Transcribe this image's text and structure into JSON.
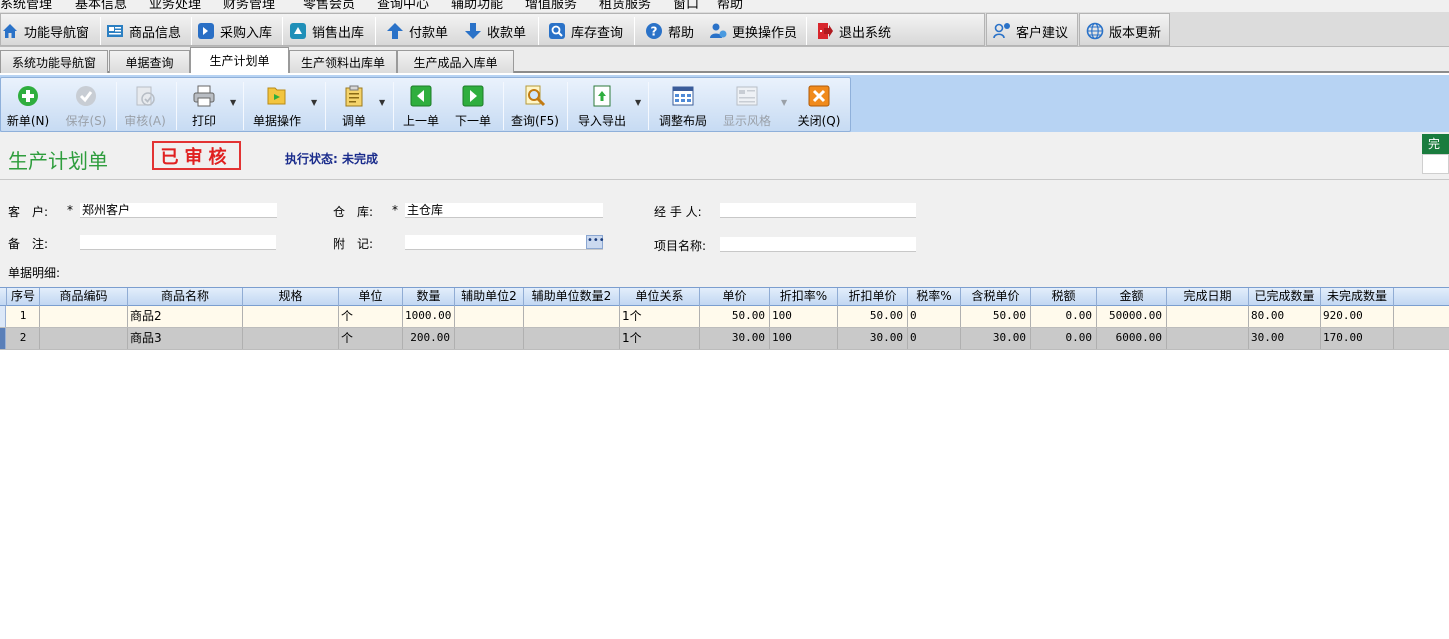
{
  "menu": [
    "系统管理",
    "基本信息",
    "业务处理",
    "财务管理",
    "零售会员",
    "查询中心",
    "辅助功能",
    "增值服务",
    "租赁服务",
    "窗口",
    "帮助"
  ],
  "quickbar": {
    "nav": "功能导航窗",
    "goods": "商品信息",
    "purchase_in": "采购入库",
    "sales_out": "销售出库",
    "payment": "付款单",
    "receipt": "收款单",
    "stock_query": "库存查询",
    "help": "帮助",
    "switch_operator": "更换操作员",
    "exit": "退出系统",
    "feedback": "客户建议",
    "update": "版本更新"
  },
  "tabs": [
    "系统功能导航窗",
    "单据查询",
    "生产计划单",
    "生产领料出库单",
    "生产成品入库单"
  ],
  "active_tab": "生产计划单",
  "toolbar": {
    "new": "新单(N)",
    "save": "保存(S)",
    "audit": "审核(A)",
    "print": "打印",
    "doc_ops": "单据操作",
    "call_doc": "调单",
    "prev": "上一单",
    "next": "下一单",
    "query": "查询(F5)",
    "import_export": "导入导出",
    "adjust_layout": "调整布局",
    "display_style": "显示风格",
    "close": "关闭(Q)"
  },
  "form": {
    "title": "生产计划单",
    "stamp": "已审核",
    "status_label": "执行状态:",
    "status_value": "未完成",
    "corner_tag": "完",
    "customer_label": "客　户:",
    "customer_required": "*",
    "customer_value": "郑州客户",
    "warehouse_label": "仓　库:",
    "warehouse_required": "*",
    "warehouse_value": "主仓库",
    "handler_label": "经 手 人:",
    "handler_value": "",
    "remark_label": "备　注:",
    "remark_value": "",
    "note_label": "附　记:",
    "note_value": "",
    "project_label": "项目名称:",
    "project_value": "",
    "detail_label": "单据明细:"
  },
  "grid": {
    "headers": [
      "序号",
      "商品编码",
      "商品名称",
      "规格",
      "单位",
      "数量",
      "辅助单位2",
      "辅助单位数量2",
      "单位关系",
      "单价",
      "折扣率%",
      "折扣单价",
      "税率%",
      "含税单价",
      "税额",
      "金额",
      "完成日期",
      "已完成数量",
      "未完成数量"
    ],
    "rows": [
      [
        "1",
        "",
        "商品2",
        "",
        "个",
        "1000.00",
        "",
        "",
        "1个",
        "50.00",
        "100",
        "50.00",
        "0",
        "50.00",
        "0.00",
        "50000.00",
        "",
        "80.00",
        "920.00"
      ],
      [
        "2",
        "",
        "商品3",
        "",
        "个",
        "200.00",
        "",
        "",
        "1个",
        "30.00",
        "100",
        "30.00",
        "0",
        "30.00",
        "0.00",
        "6000.00",
        "",
        "30.00",
        "170.00"
      ]
    ]
  },
  "colors": {
    "title_green": "#2e9d3d",
    "stamp_red": "#e02020",
    "status_blue": "#1a2c8c",
    "toolbar_blue": "#b7d3f3",
    "row_highlight": "#fffaec",
    "row_selected": "#c9c9c9"
  }
}
